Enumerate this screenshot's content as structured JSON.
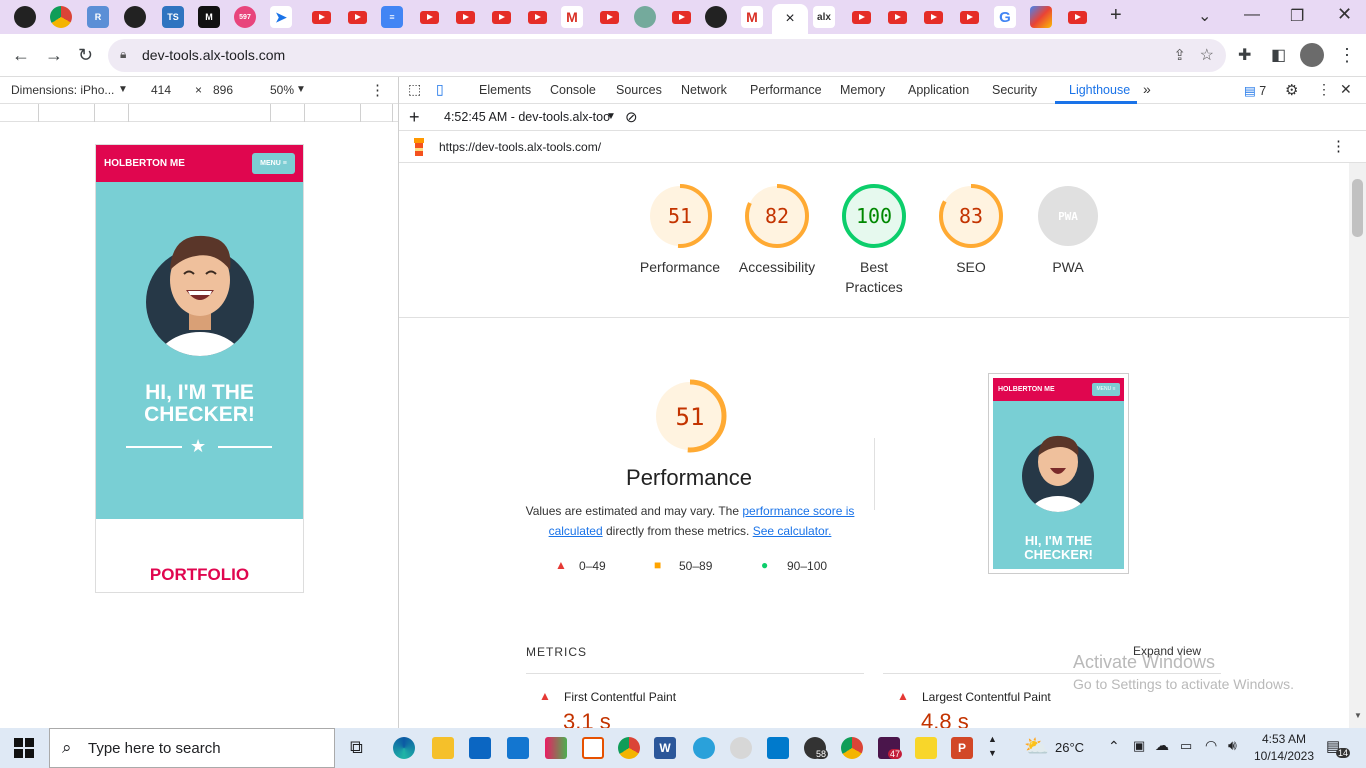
{
  "browser": {
    "url": "dev-tools.alx-tools.com",
    "active_tab_close": "×",
    "tab_badge_count": "597"
  },
  "device_toolbar": {
    "dimensions_label": "Dimensions: iPho...",
    "width": "414",
    "times": "×",
    "height": "896",
    "zoom": "50%"
  },
  "devtools": {
    "tabs": [
      "Elements",
      "Console",
      "Sources",
      "Network",
      "Performance",
      "Memory",
      "Application",
      "Security",
      "Lighthouse"
    ],
    "active_tab": "Lighthouse",
    "issues_count": "7",
    "report_selector": "4:52:45 AM - dev-tools.alx-too",
    "report_url": "https://dev-tools.alx-tools.com/"
  },
  "phone": {
    "brand": "HOLBERTON ME",
    "menu": "MENU ≡",
    "hero_line1": "HI, I'M THE",
    "hero_line2": "CHECKER!",
    "portfolio": "PORTFOLIO"
  },
  "scores": [
    {
      "value": "51",
      "label": "Performance",
      "color": "#c33300",
      "ring": "#ffaa33",
      "bg": "#fff3e0",
      "fraction": 0.51
    },
    {
      "value": "82",
      "label": "Accessibility",
      "color": "#c33300",
      "ring": "#ffaa33",
      "bg": "#fff3e0",
      "fraction": 0.82
    },
    {
      "value": "100",
      "label": "Best Practices",
      "color": "#008800",
      "ring": "#0cce6b",
      "bg": "#e6f9ee",
      "fraction": 1.0
    },
    {
      "value": "83",
      "label": "SEO",
      "color": "#c33300",
      "ring": "#ffaa33",
      "bg": "#fff3e0",
      "fraction": 0.83
    },
    {
      "value": "PWA",
      "label": "PWA",
      "color": "#bbb",
      "ring": "#e0e0e0",
      "bg": "#e0e0e0",
      "fraction": 0
    }
  ],
  "performance": {
    "score": "51",
    "title": "Performance",
    "desc_pre": "Values are estimated and may vary. The ",
    "desc_link1": "performance score is calculated",
    "desc_mid": " directly from these metrics. ",
    "desc_link2": "See calculator.",
    "legend": [
      "0–49",
      "50–89",
      "90–100"
    ]
  },
  "metrics": {
    "heading": "METRICS",
    "expand": "Expand view",
    "items": [
      {
        "label": "First Contentful Paint",
        "value": "3.1 s"
      },
      {
        "label": "Largest Contentful Paint",
        "value": "4.8 s"
      }
    ]
  },
  "watermark": {
    "line1": "Activate Windows",
    "line2": "Go to Settings to activate Windows."
  },
  "taskbar": {
    "search_placeholder": "Type here to search",
    "temperature": "26°C",
    "time": "4:53 AM",
    "date": "10/14/2023",
    "notif_count": "14",
    "whatsapp_badge": "58",
    "slack_badge": "47"
  }
}
